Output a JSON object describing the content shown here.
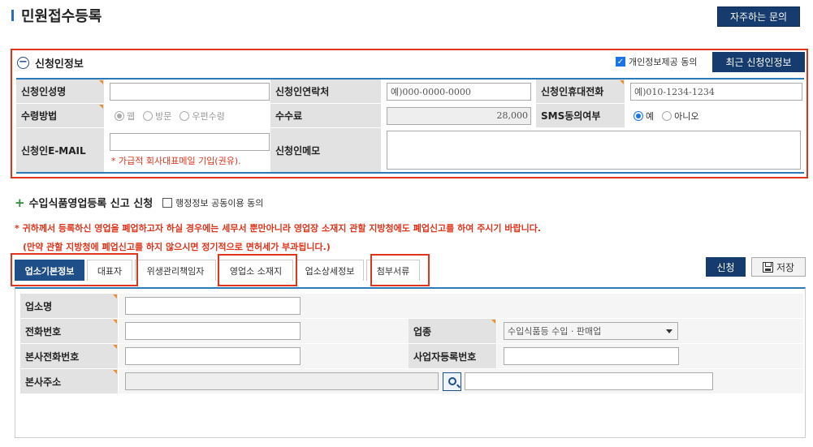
{
  "header": {
    "title": "민원접수등록",
    "faq_button": "자주하는 문의"
  },
  "applicant": {
    "title": "신청인정보",
    "privacy_consent_label": "개인정보제공 동의",
    "privacy_consent_checked": true,
    "recent_button": "최근 신청인정보",
    "fields": {
      "name_label": "신청인성명",
      "contact_label": "신청인연락처",
      "contact_placeholder": "예)000-0000-0000",
      "mobile_label": "신청인휴대전화",
      "mobile_placeholder": "예)010-1234-1234",
      "receive_label": "수령방법",
      "receive_options": [
        "웹",
        "방문",
        "우편수령"
      ],
      "fee_label": "수수료",
      "fee_value": "28,000",
      "sms_label": "SMS동의여부",
      "sms_options": [
        "예",
        "아니오"
      ],
      "email_label": "신청인E-MAIL",
      "email_hint": "* 가급적 회사대표메일 기입(권유).",
      "memo_label": "신청인메모"
    }
  },
  "business_section": {
    "title": "수입식품영업등록 신고 신청",
    "admin_share_label": "행정정보 공동이용 동의",
    "notice_line1": "* 귀하께서 등록하신 영업을 폐업하고자 하실 경우에는 세무서 뿐만아니라 영업장 소재지 관할 지방청에도 폐업신고를 하여 주시기 바랍니다.",
    "notice_line2": "(만약 관할 지방청에 폐업신고를 하지 않으시면 정기적으로 면허세가 부과됩니다.)",
    "tabs": [
      {
        "label": "업소기본정보"
      },
      {
        "label": "대표자"
      },
      {
        "label": "위생관리책임자"
      },
      {
        "label": "영업소 소재지"
      },
      {
        "label": "업소상세정보"
      },
      {
        "label": "첨부서류"
      }
    ],
    "apply_button": "신청",
    "save_button": "저장",
    "fields": {
      "biz_name_label": "업소명",
      "phone_label": "전화번호",
      "biz_type_label": "업종",
      "biz_type_value": "수입식품등 수입 · 판매업",
      "hq_phone_label": "본사전화번호",
      "biz_reg_label": "사업자등록번호",
      "hq_address_label": "본사주소"
    }
  }
}
